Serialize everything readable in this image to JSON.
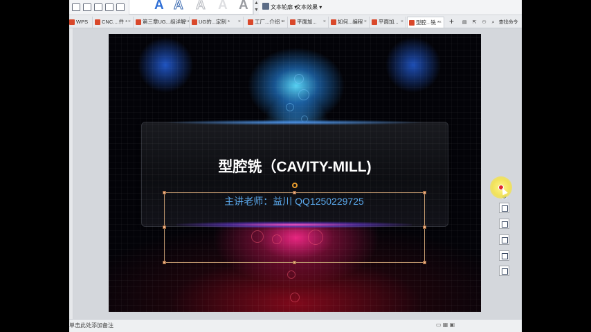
{
  "ribbon": {
    "glyph_sample": "A",
    "scroll_up": "▲",
    "scroll_down": "▼",
    "text_outline_label": "文本轮廓 ▾",
    "text_effect_label": "文本效果 ▾"
  },
  "tabs": [
    {
      "label": "WPS",
      "icon": "wps-logo-icon"
    },
    {
      "label": "CNC....件 *"
    },
    {
      "label": "第三章UG...组详解 *"
    },
    {
      "label": "UG的...定制 *"
    },
    {
      "label": "工厂...介绍 *"
    },
    {
      "label": "平面加..."
    },
    {
      "label": "如何...编程"
    },
    {
      "label": "平面加..."
    },
    {
      "label": "型腔...铣 *",
      "active": true
    }
  ],
  "tab_close": "×",
  "tab_add": "+",
  "tab_tools": {
    "search_label": "查找命令"
  },
  "slide": {
    "title": "型腔铣（CAVITY-MILL)",
    "subtitle": "主讲老师：益川 QQ1250229725"
  },
  "notes": {
    "placeholder": "单击此处添加备注"
  },
  "colors": {
    "subtitle": "#5aa8ec",
    "selection_handle": "#f2b183",
    "cursor_highlight": "#f1e25a"
  }
}
